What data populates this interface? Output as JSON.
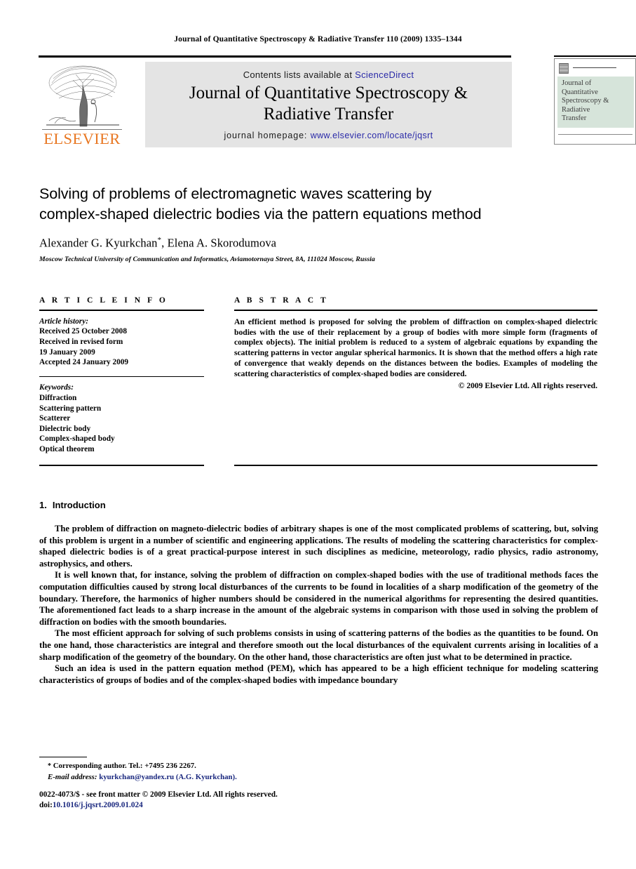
{
  "running_head": "Journal of Quantitative Spectroscopy & Radiative Transfer 110 (2009) 1335–1344",
  "masthead": {
    "publisher_name": "ELSEVIER",
    "contents_prefix": "Contents lists available at ",
    "sciencedirect": "ScienceDirect",
    "journal_title_line1": "Journal of Quantitative Spectroscopy &",
    "journal_title_line2": "Radiative Transfer",
    "homepage_prefix": "journal homepage: ",
    "homepage_url": "www.elsevier.com/locate/jqsrt",
    "link_color": "#2a2aa8",
    "elsevier_orange": "#E87722",
    "box_gray": "#e4e4e4",
    "cover": {
      "line1": "Journal of",
      "line2": "Quantitative",
      "line3": "Spectroscopy &",
      "line4": "Radiative",
      "line5": "Transfer",
      "block_color": "#d6e4da"
    }
  },
  "article": {
    "title_line1": "Solving of problems of electromagnetic waves scattering by",
    "title_line2": "complex-shaped dielectric bodies via the pattern equations method",
    "authors": "Alexander G. Kyurkchan",
    "authors_marker": "*",
    "authors_rest": ", Elena A. Skorodumova",
    "affiliation": "Moscow Technical University of Communication and Informatics, Aviamotornaya Street, 8A, 111024 Moscow, Russia"
  },
  "article_info": {
    "heading": "A R T I C L E    I N F O",
    "history_label": "Article history:",
    "history_lines": [
      "Received 25 October 2008",
      "Received in revised form",
      "19 January 2009",
      "Accepted 24 January 2009"
    ],
    "keywords_label": "Keywords:",
    "keywords": [
      "Diffraction",
      "Scattering pattern",
      "Scatterer",
      "Dielectric body",
      "Complex-shaped body",
      "Optical theorem"
    ]
  },
  "abstract": {
    "heading": "A B S T R A C T",
    "body": "An efficient method is proposed for solving the problem of diffraction on complex-shaped dielectric bodies with the use of their replacement by a group of bodies with more simple form (fragments of complex objects). The initial problem is reduced to a system of algebraic equations by expanding the scattering patterns in vector angular spherical harmonics. It is shown that the method offers a high rate of convergence that weakly depends on the distances between the bodies. Examples of modeling the scattering characteristics of complex-shaped bodies are considered.",
    "copyright": "© 2009 Elsevier Ltd. All rights reserved."
  },
  "section": {
    "number": "1.",
    "title": "Introduction",
    "paragraphs": [
      "The problem of diffraction on magneto-dielectric bodies of arbitrary shapes is one of the most complicated problems of scattering, but, solving of this problem is urgent in a number of scientific and engineering applications. The results of modeling the scattering characteristics for complex-shaped dielectric bodies is of a great practical-purpose interest in such disciplines as medicine, meteorology, radio physics, radio astronomy, astrophysics, and others.",
      "It is well known that, for instance, solving the problem of diffraction on complex-shaped bodies with the use of traditional methods faces the computation difficulties caused by strong local disturbances of the currents to be found in localities of a sharp modification of the geometry of the boundary. Therefore, the harmonics of higher numbers should be considered in the numerical algorithms for representing the desired quantities. The aforementioned fact leads to a sharp increase in the amount of the algebraic systems in comparison with those used in solving the problem of diffraction on bodies with the smooth boundaries.",
      "The most efficient approach for solving of such problems consists in using of scattering patterns of the bodies as the quantities to be found. On the one hand, those characteristics are integral and therefore smooth out the local disturbances of the equivalent currents arising in localities of a sharp modification of the geometry of the boundary. On the other hand, those characteristics are often just what to be determined in practice.",
      "Such an idea is used in the pattern equation method (PEM), which has appeared to be a high efficient technique for modeling scattering characteristics of groups of bodies and of the complex-shaped bodies with impedance boundary"
    ]
  },
  "footer": {
    "corresponding_star": "*",
    "corresponding_text": "Corresponding author. Tel.: +7495 236 2267.",
    "email_label": "E-mail address:",
    "email_value": "kyurkchan@yandex.ru",
    "email_attrib": "(A.G. Kyurkchan).",
    "imprint": "0022-4073/$ - see front matter © 2009 Elsevier Ltd. All rights reserved.",
    "doi_label": "doi:",
    "doi_value": "10.1016/j.jqsrt.2009.01.024",
    "link_color": "#19277e"
  }
}
